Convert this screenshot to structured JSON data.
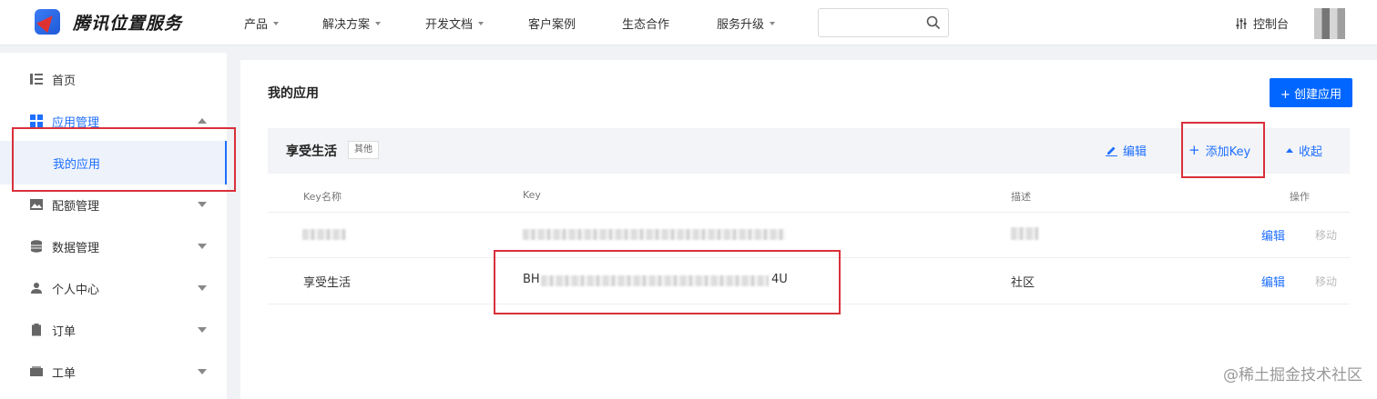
{
  "brand": {
    "name": "腾讯位置服务"
  },
  "nav": {
    "items": [
      {
        "label": "产品",
        "has_menu": true
      },
      {
        "label": "解决方案",
        "has_menu": true
      },
      {
        "label": "开发文档",
        "has_menu": true
      },
      {
        "label": "客户案例",
        "has_menu": false
      },
      {
        "label": "生态合作",
        "has_menu": false
      },
      {
        "label": "服务升级",
        "has_menu": true
      }
    ],
    "search_placeholder": "",
    "console_label": "控制台"
  },
  "sidebar": {
    "items": [
      {
        "label": "首页",
        "icon": "list-icon"
      },
      {
        "label": "应用管理",
        "icon": "grid-icon",
        "expanded": true
      },
      {
        "label": "配额管理",
        "icon": "image-icon"
      },
      {
        "label": "数据管理",
        "icon": "database-icon"
      },
      {
        "label": "个人中心",
        "icon": "user-icon"
      },
      {
        "label": "订单",
        "icon": "clipboard-icon"
      },
      {
        "label": "工单",
        "icon": "ticket-icon"
      }
    ],
    "sub_active": "我的应用"
  },
  "main": {
    "title": "我的应用",
    "create_button": "+ 创建应用",
    "app": {
      "name": "享受生活",
      "tag": "其他",
      "edit_label": "编辑",
      "add_key_label": "添加Key",
      "collapse_label": "收起"
    },
    "table": {
      "headers": [
        "Key名称",
        "Key",
        "描述",
        "操作"
      ],
      "rows": [
        {
          "name": "",
          "key": "",
          "desc": "",
          "edit": "编辑",
          "move": "移动"
        },
        {
          "name": "享受生活",
          "key_prefix": "BH",
          "key_suffix": "4U",
          "desc": "社区",
          "edit": "编辑",
          "move": "移动"
        }
      ]
    }
  },
  "watermark": "@稀土掘金技术社区",
  "colors": {
    "accent": "#1e6fff",
    "primary_button": "#0066ff",
    "highlight": "#d9303a"
  }
}
